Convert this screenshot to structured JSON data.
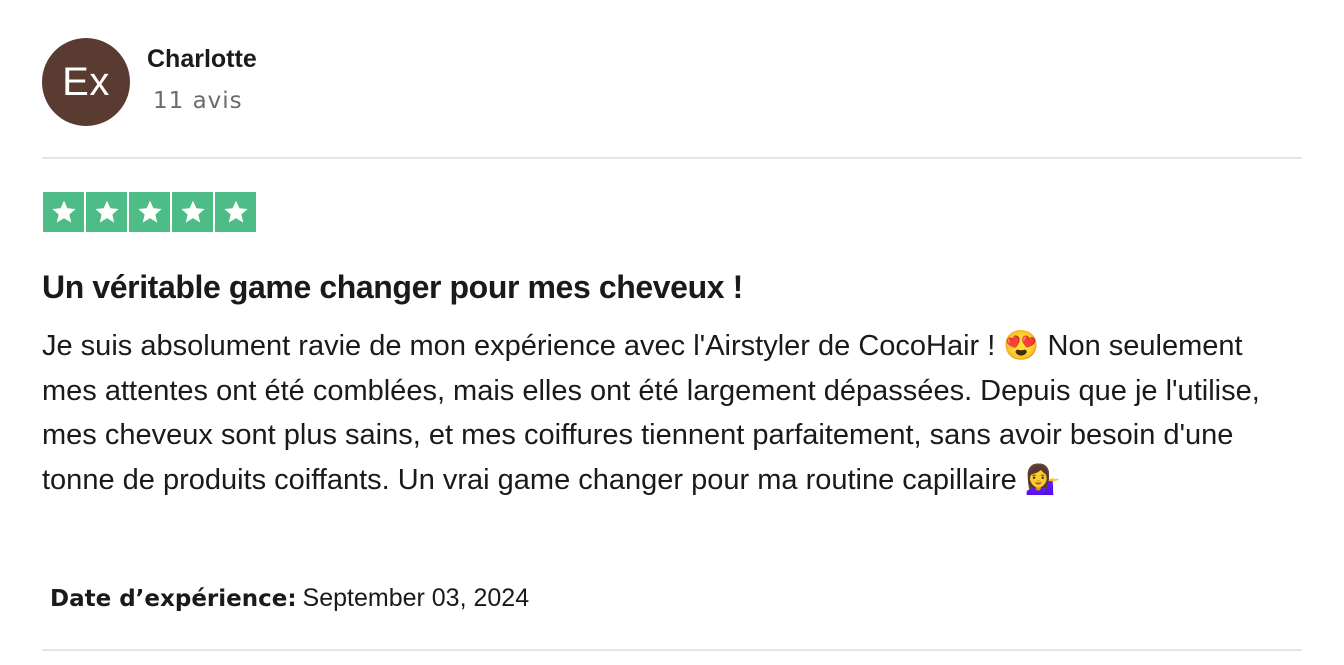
{
  "reviewer": {
    "avatar_initials": "Ex",
    "avatar_color": "#5a3b32",
    "name": "Charlotte",
    "review_count": "11 avis"
  },
  "rating": {
    "stars": 5,
    "max_stars": 5,
    "star_color": "#4ebc86",
    "icon": "star-icon"
  },
  "review": {
    "title": "Un véritable game changer pour mes cheveux !",
    "body": "Je suis absolument ravie de mon expérience avec l'Airstyler de CocoHair ! 😍 Non seulement mes attentes ont été comblées, mais elles ont été largement dépassées. Depuis que je l'utilise, mes cheveux sont plus sains, et mes coiffures tiennent parfaitement, sans avoir besoin d'une tonne de produits coiffants. Un vrai game changer pour ma routine capillaire 💁‍♀️"
  },
  "experience": {
    "label": "Date d’expérience:",
    "date": "September 03, 2024"
  }
}
